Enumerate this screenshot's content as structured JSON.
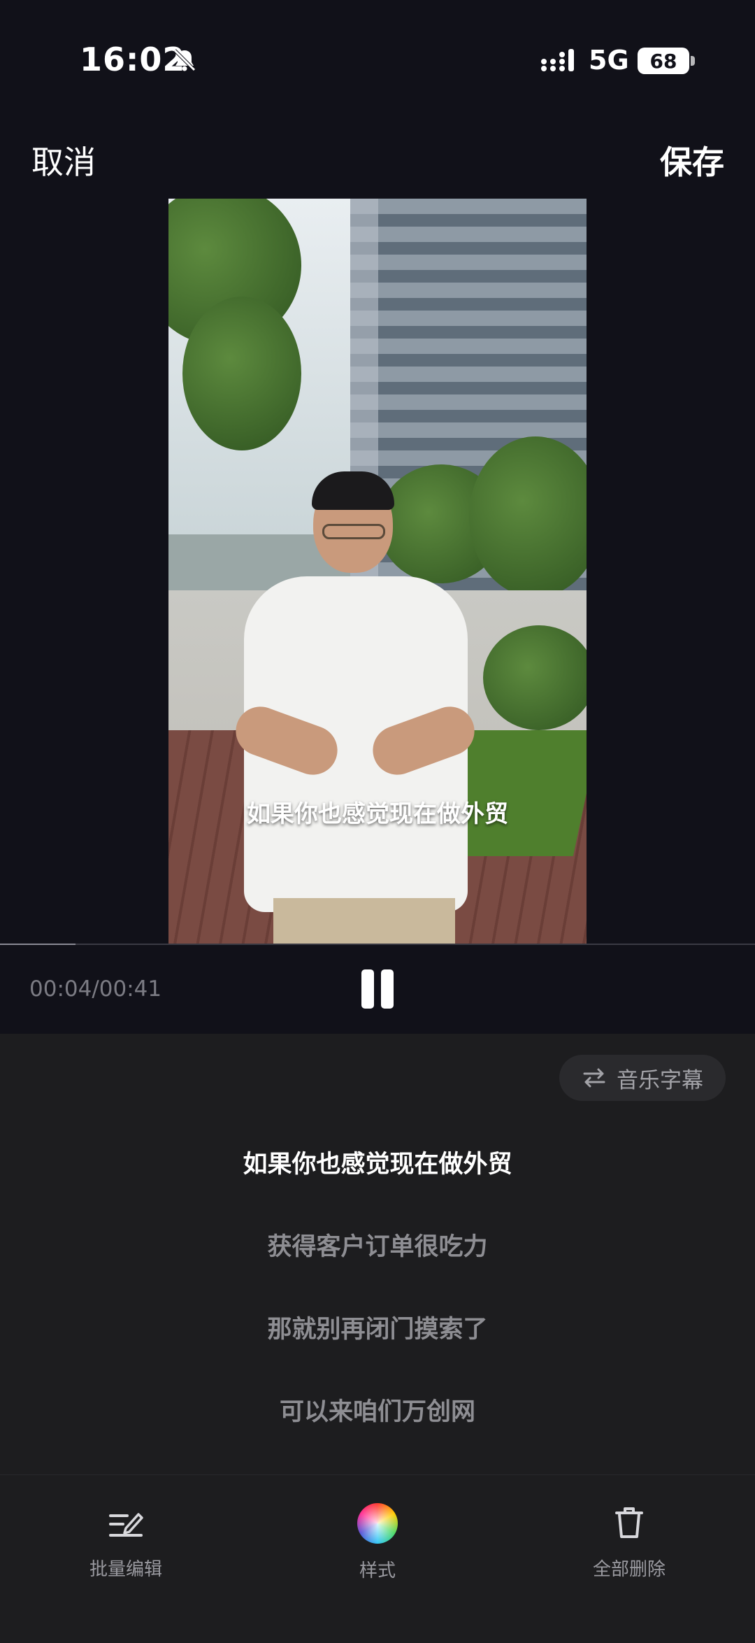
{
  "status_bar": {
    "time": "16:02",
    "network": "5G",
    "battery": "68"
  },
  "nav": {
    "cancel": "取消",
    "save": "保存"
  },
  "video": {
    "caption": "如果你也感觉现在做外贸"
  },
  "playback": {
    "time": "00:04/00:41",
    "progress_fraction": 0.1
  },
  "panel": {
    "mode_toggle": "音乐字幕",
    "subtitles": [
      {
        "text": "如果你也感觉现在做外贸",
        "active": true
      },
      {
        "text": "获得客户订单很吃力",
        "active": false
      },
      {
        "text": "那就别再闭门摸索了",
        "active": false
      },
      {
        "text": "可以来咱们万创网",
        "active": false
      }
    ]
  },
  "toolbar": {
    "batch_edit": "批量编辑",
    "style": "样式",
    "delete_all": "全部删除"
  },
  "icons": [
    "bell-slash-icon",
    "signal-icon",
    "battery-icon",
    "pause-icon",
    "swap-icon",
    "edit-lines-icon",
    "color-wheel-icon",
    "trash-icon"
  ]
}
